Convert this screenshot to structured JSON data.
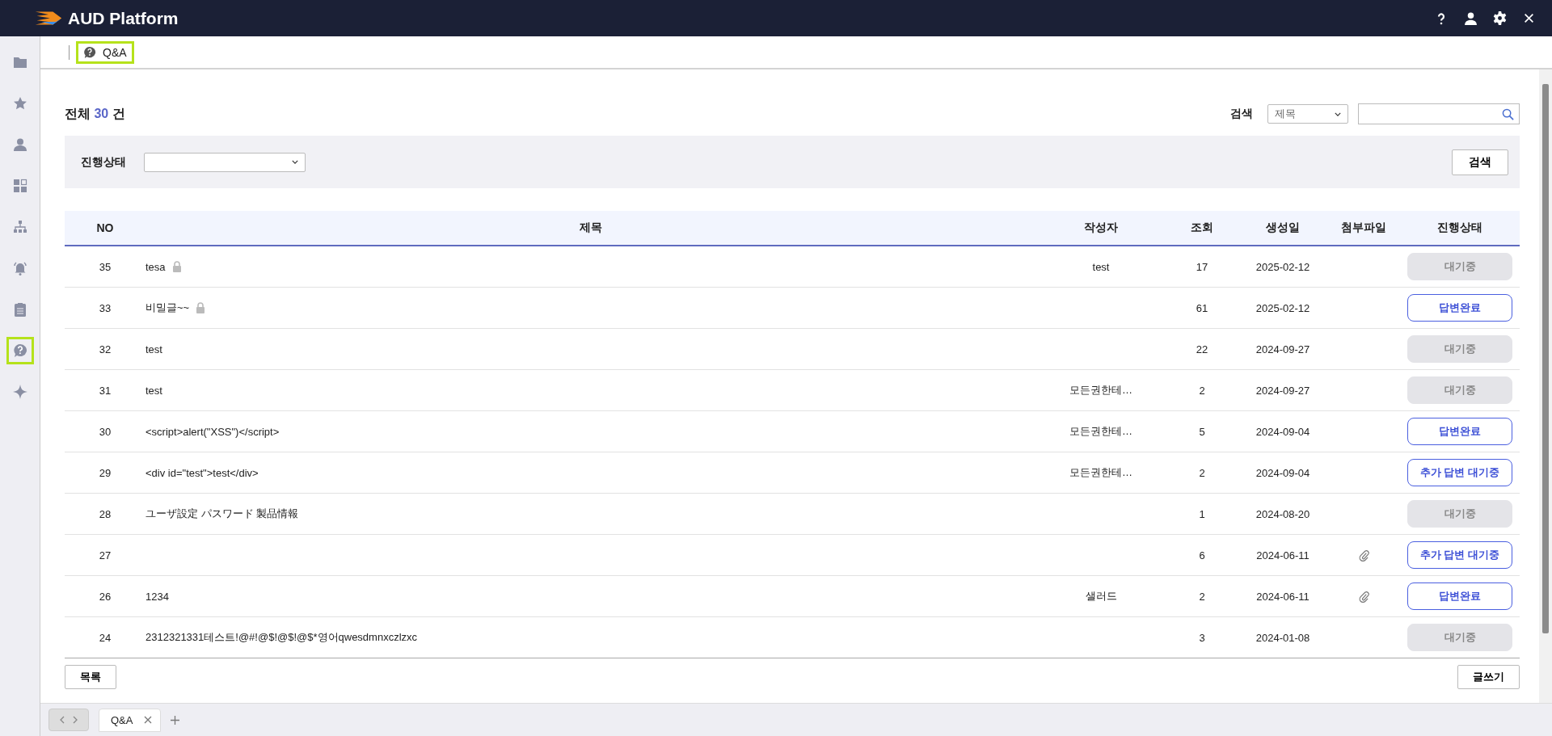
{
  "app": {
    "title": "AUD Platform"
  },
  "sidebar": {
    "items": [
      {
        "selected": false
      },
      {
        "selected": false
      },
      {
        "selected": false
      },
      {
        "selected": false
      },
      {
        "selected": false
      },
      {
        "selected": false
      },
      {
        "selected": false
      },
      {
        "selected": true
      },
      {
        "selected": false
      }
    ]
  },
  "breadcrumb": {
    "label": "Q&A",
    "selected": true
  },
  "summary": {
    "label": "전체",
    "count": "30",
    "unit": "건"
  },
  "search": {
    "label": "검색",
    "field_select": "제목"
  },
  "filter": {
    "label": "진행상태",
    "button": "검색"
  },
  "table": {
    "columns": [
      "NO",
      "제목",
      "작성자",
      "조회",
      "생성일",
      "첨부파일",
      "진행상태"
    ],
    "rows": [
      {
        "no": "35",
        "title": "tesa",
        "locked": true,
        "author": "test",
        "views": "17",
        "date": "2025-02-12",
        "attachment": false,
        "status": {
          "kind": "waiting",
          "label": "대기중"
        }
      },
      {
        "no": "33",
        "title": "비밀글~~",
        "locked": true,
        "author": "",
        "views": "61",
        "date": "2025-02-12",
        "attachment": false,
        "status": {
          "kind": "answered",
          "label": "답변완료"
        }
      },
      {
        "no": "32",
        "title": "test",
        "locked": false,
        "author": "",
        "views": "22",
        "date": "2024-09-27",
        "attachment": false,
        "status": {
          "kind": "waiting",
          "label": "대기중"
        }
      },
      {
        "no": "31",
        "title": "test",
        "locked": false,
        "author": "모든권한테…",
        "views": "2",
        "date": "2024-09-27",
        "attachment": false,
        "status": {
          "kind": "waiting",
          "label": "대기중"
        }
      },
      {
        "no": "30",
        "title": "<script>alert(\"XSS\")</script>",
        "locked": false,
        "author": "모든권한테…",
        "views": "5",
        "date": "2024-09-04",
        "attachment": false,
        "status": {
          "kind": "answered",
          "label": "답변완료"
        }
      },
      {
        "no": "29",
        "title": "<div id=\"test\">test</div>",
        "locked": false,
        "author": "모든권한테…",
        "views": "2",
        "date": "2024-09-04",
        "attachment": false,
        "status": {
          "kind": "additional",
          "label": "추가 답변 대기중"
        }
      },
      {
        "no": "28",
        "title": "ユーザ設定 パスワード 製品情報",
        "locked": false,
        "author": "",
        "views": "1",
        "date": "2024-08-20",
        "attachment": false,
        "status": {
          "kind": "waiting",
          "label": "대기중"
        }
      },
      {
        "no": "27",
        "title": "",
        "locked": false,
        "author": "",
        "views": "6",
        "date": "2024-06-11",
        "attachment": true,
        "status": {
          "kind": "additional",
          "label": "추가 답변 대기중"
        }
      },
      {
        "no": "26",
        "title": "1234",
        "locked": false,
        "author": "샐러드",
        "views": "2",
        "date": "2024-06-11",
        "attachment": true,
        "status": {
          "kind": "answered",
          "label": "답변완료"
        }
      },
      {
        "no": "24",
        "title": "2312321331테스트!@#!@$!@$!@$*영어qwesdmnxczlzxc",
        "locked": false,
        "author": "",
        "views": "3",
        "date": "2024-01-08",
        "attachment": false,
        "status": {
          "kind": "waiting",
          "label": "대기중"
        }
      }
    ]
  },
  "footer_buttons": {
    "list": "목록",
    "write": "글쓰기"
  },
  "bottom_tabs": [
    {
      "label": "Q&A",
      "selected": true
    }
  ]
}
